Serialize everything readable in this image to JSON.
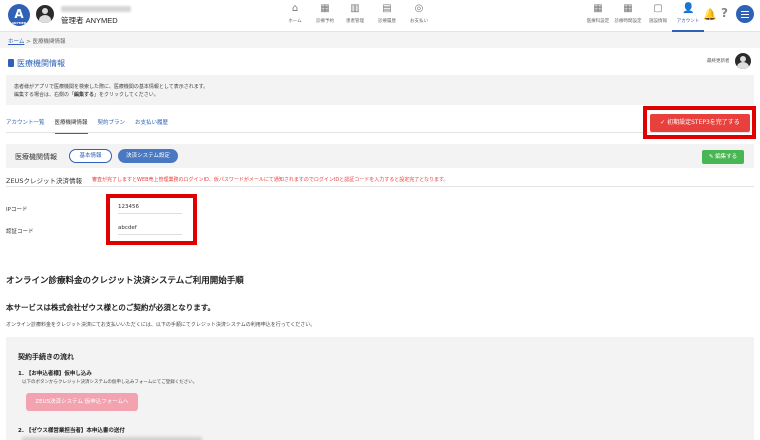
{
  "header": {
    "logo_text": "A",
    "logo_sub": "ANYMED",
    "user_label": "管理者 ANYMED",
    "nav_items": [
      {
        "label": "ホーム",
        "icon": "home-icon",
        "glyph": "⌂"
      },
      {
        "label": "診療予約",
        "icon": "calendar-icon",
        "glyph": "▦"
      },
      {
        "label": "患者管理",
        "icon": "patient-icon",
        "glyph": "▥"
      },
      {
        "label": "診療履歴",
        "icon": "history-icon",
        "glyph": "▤"
      },
      {
        "label": "お支払い",
        "icon": "payment-icon",
        "glyph": "◎"
      }
    ],
    "right_items": [
      {
        "label": "医療科設定",
        "icon": "department-icon",
        "glyph": "▦"
      },
      {
        "label": "診療時間設定",
        "icon": "schedule-icon",
        "glyph": "▦"
      },
      {
        "label": "施設情報",
        "icon": "folder-icon",
        "glyph": "▢"
      },
      {
        "label": "アカウント",
        "icon": "user-icon",
        "glyph": "👤"
      }
    ],
    "help": "?",
    "bell": "🔔"
  },
  "breadcrumb": {
    "home": "ホーム",
    "sep": " > ",
    "current": "医療機関情報"
  },
  "page": {
    "title": "医療機関情報",
    "updated_by": "最終更新者",
    "notice_line1": "患者様がアプリで医療機関を検索した際に、医療機関の基本情報として表示されます。",
    "notice_line2_a": "編集する場合は、右側の「",
    "notice_line2_bold": "編集する",
    "notice_line2_b": "」をクリックしてください。"
  },
  "tabs": [
    {
      "label": "アカウント一覧",
      "active": false
    },
    {
      "label": "医療機関情報",
      "active": true
    },
    {
      "label": "契約プラン",
      "active": false
    },
    {
      "label": "お支払い履歴",
      "active": false
    }
  ],
  "complete_button": "✓ 初期設定STEP3を完了する",
  "subbar": {
    "title": "医療機関情報",
    "basic": "基本情報",
    "payment": "決済システム設定",
    "edit": "✎ 編集する"
  },
  "zeus": {
    "title": "ZEUSクレジット決済情報",
    "warning": "審査が完了しますとWEB売上管理業務のログインID、仮パスワードがメールにて通知されますのでログインIDと認証コードを入力すると設定完了となります。",
    "ip_label": "IPコード",
    "ip_value": "123456",
    "auth_label": "認証コード",
    "auth_value": "abcdef"
  },
  "guide": {
    "heading": "オンライン診療料金のクレジット決済システムご利用開始手順",
    "service_heading": "本サービスは株式会社ゼウス様とのご契約が必須となります。",
    "service_text": "オンライン診療料金をクレジット決済にてお支払いいただくには、以下の手順にてクレジット決済システムの利用申込を行ってください。",
    "flow_title": "契約手続きの流れ",
    "step1": "1. 【お申込者様】仮申し込み",
    "step1_desc": "以下のボタンからクレジット決済システムの仮申し込みフォームにてご登録ください。",
    "step1_button": "ZEUS決済システム 仮申込フォームへ",
    "step2": "2. 【ゼウス様営業担当者】本申込書の送付"
  }
}
